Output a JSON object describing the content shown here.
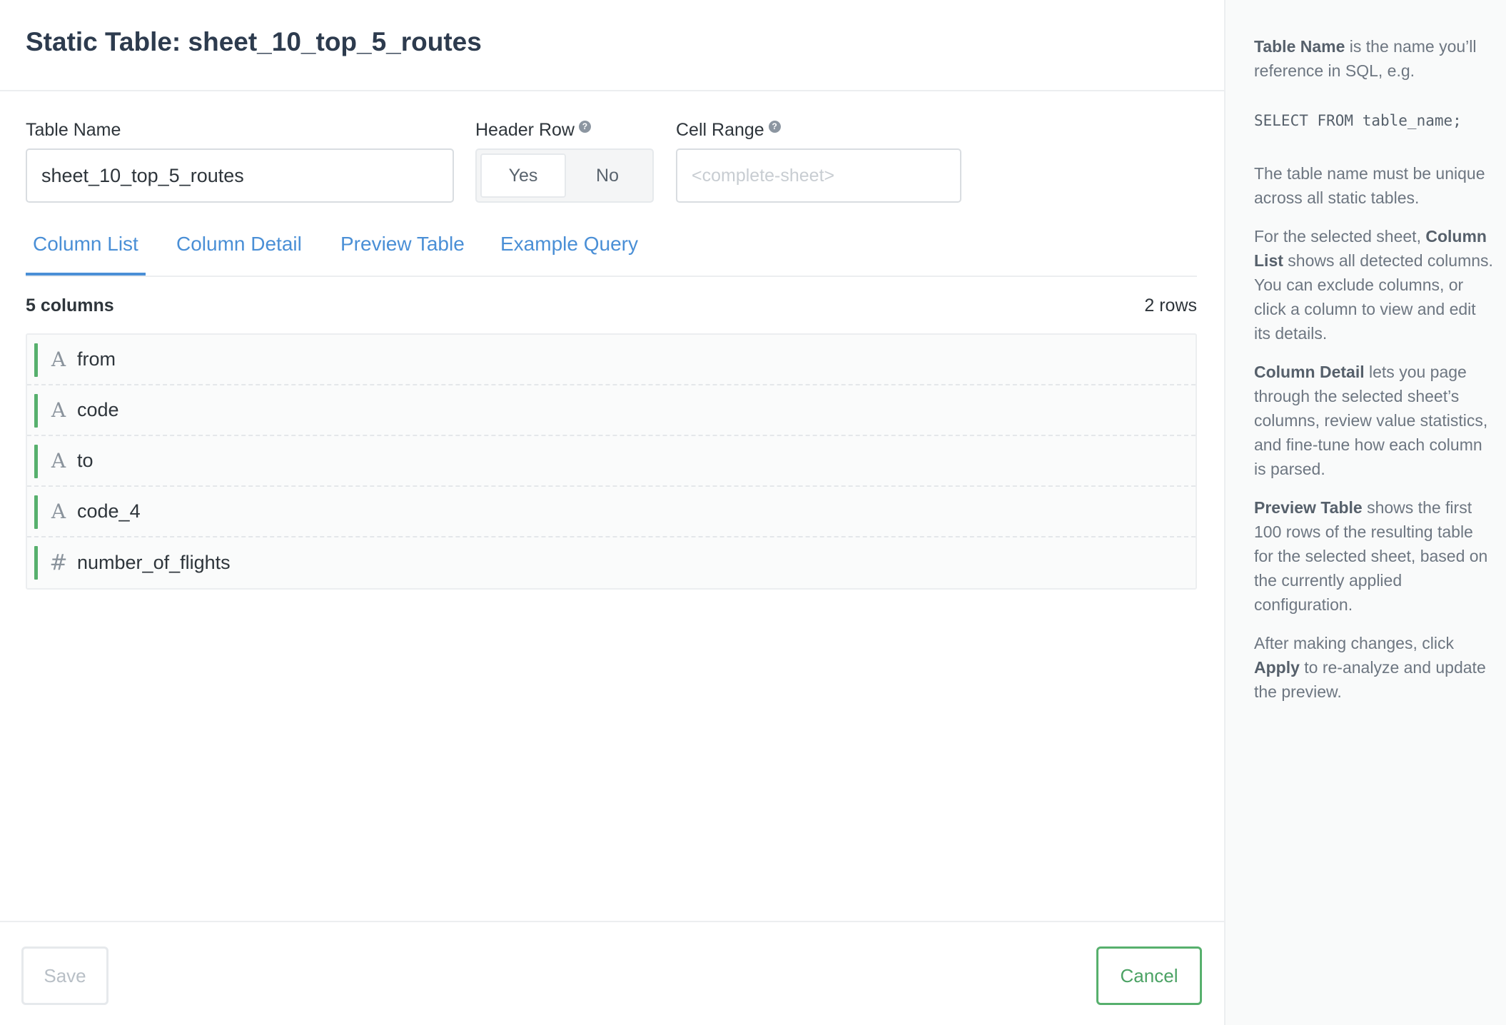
{
  "header": {
    "title": "Static Table: sheet_10_top_5_routes"
  },
  "form": {
    "table_name_label": "Table Name",
    "table_name_value": "sheet_10_top_5_routes",
    "header_row_label": "Header Row",
    "header_row_options": [
      "Yes",
      "No"
    ],
    "header_row_selected": "Yes",
    "cell_range_label": "Cell Range",
    "cell_range_placeholder": "<complete-sheet>",
    "help_glyph": "?"
  },
  "tabs": [
    "Column List",
    "Column Detail",
    "Preview Table",
    "Example Query"
  ],
  "active_tab": "Column List",
  "summary": {
    "columns": "5 columns",
    "rows": "2 rows"
  },
  "columns": [
    {
      "name": "from",
      "type_icon": "A",
      "type": "text-type-icon"
    },
    {
      "name": "code",
      "type_icon": "A",
      "type": "text-type-icon"
    },
    {
      "name": "to",
      "type_icon": "A",
      "type": "text-type-icon"
    },
    {
      "name": "code_4",
      "type_icon": "A",
      "type": "text-type-icon"
    },
    {
      "name": "number_of_flights",
      "type_icon": "#",
      "type": "number-type-icon"
    }
  ],
  "footer": {
    "save_label": "Save",
    "cancel_label": "Cancel"
  },
  "help": {
    "p1_bold": "Table Name",
    "p1_rest": " is the name you’ll reference in SQL, e.g.",
    "code": "SELECT FROM table_name;",
    "p2": "The table name must be unique across all static tables.",
    "p3_lead": "For the selected sheet, ",
    "p3_bold": "Column List",
    "p3_rest": " shows all detected columns. You can exclude columns, or click a column to view and edit its details.",
    "p4_bold": "Column Detail",
    "p4_rest": " lets you page through the selected sheet’s columns, review value statistics, and fine-tune how each column is parsed.",
    "p5_bold": "Preview Table",
    "p5_rest": " shows the first 100 rows of the resulting table for the selected sheet, based on the currently applied configuration.",
    "p6_lead": "After making changes, click ",
    "p6_bold": "Apply",
    "p6_rest": " to re-analyze and update the preview."
  },
  "colors": {
    "accent": "#4a8fd6",
    "success": "#57b06d"
  }
}
